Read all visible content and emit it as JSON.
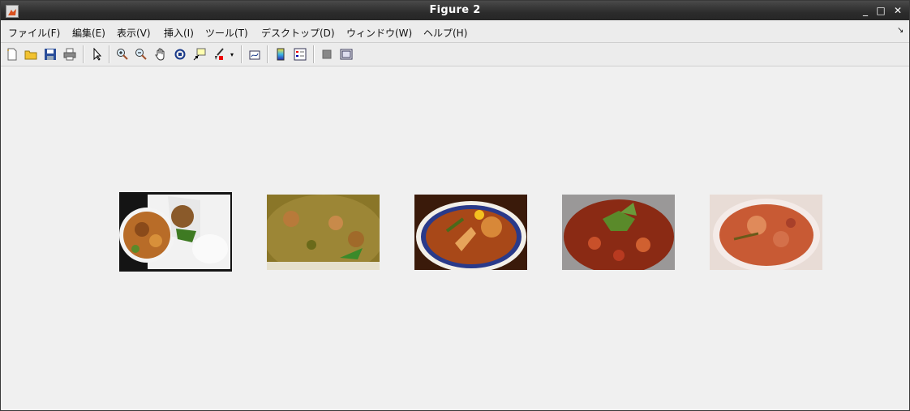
{
  "window": {
    "title": "Figure 2"
  },
  "menu": {
    "file": "ファイル(F)",
    "edit": "編集(E)",
    "view": "表示(V)",
    "insert": "挿入(I)",
    "tools": "ツール(T)",
    "desktop": "デスクトップ(D)",
    "window": "ウィンドウ(W)",
    "help": "ヘルプ(H)"
  },
  "toolbar_icons": [
    "new-figure-icon",
    "open-file-icon",
    "save-icon",
    "print-icon",
    "edit-plot-arrow-icon",
    "zoom-in-icon",
    "zoom-out-icon",
    "pan-hand-icon",
    "rotate-3d-icon",
    "data-cursor-icon",
    "brush-icon",
    "brush-dropdown-icon",
    "link-plot-icon",
    "colorbar-icon",
    "legend-icon",
    "hide-plot-tools-icon",
    "show-plot-tools-icon"
  ],
  "images": [
    {
      "name": "curry-bento-photo",
      "colors": [
        "#1a1a1a",
        "#b8702a",
        "#e8e8e8",
        "#4a7a2a"
      ]
    },
    {
      "name": "green-curry-photo",
      "colors": [
        "#8a7a2a",
        "#a68a3a",
        "#5a6a1a",
        "#c99a4a"
      ]
    },
    {
      "name": "red-curry-bowl-photo",
      "colors": [
        "#6a2a0a",
        "#c0561a",
        "#2a3a7a",
        "#e6a060"
      ]
    },
    {
      "name": "spicy-curry-basil-photo",
      "colors": [
        "#8a2a1a",
        "#c0402a",
        "#5a7a2a",
        "#d06a3a"
      ]
    },
    {
      "name": "red-curry-soup-photo",
      "colors": [
        "#c05a3a",
        "#e08a5a",
        "#f0e0d8",
        "#a0402a"
      ]
    }
  ]
}
